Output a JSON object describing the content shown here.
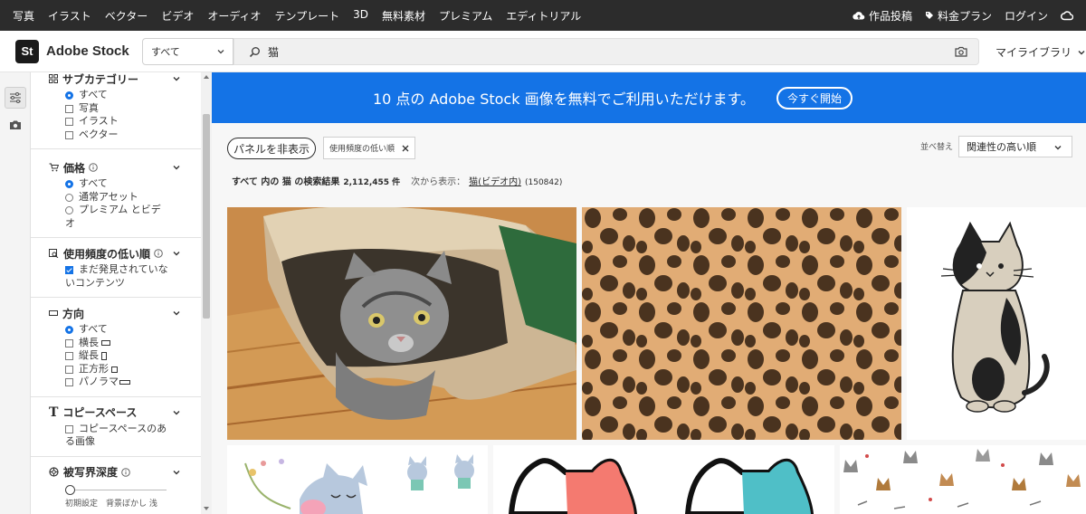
{
  "topnav": {
    "items": [
      "写真",
      "イラスト",
      "ベクター",
      "ビデオ",
      "オーディオ",
      "テンプレート",
      "3D",
      "無料素材",
      "プレミアム",
      "エディトリアル"
    ],
    "right": {
      "upload": "作品投稿",
      "pricing": "料金プラン",
      "login": "ログイン"
    }
  },
  "header": {
    "logo_badge": "St",
    "logo_text": "Adobe Stock",
    "category": "すべて",
    "search_value": "猫",
    "library": "マイライブラリ"
  },
  "filters": {
    "subcategory": {
      "title": "サブカテゴリー",
      "options": [
        {
          "label": "すべて",
          "checked": true
        },
        {
          "label": "写真",
          "checked": false
        },
        {
          "label": "イラスト",
          "checked": false
        },
        {
          "label": "ベクター",
          "checked": false
        }
      ]
    },
    "price": {
      "title": "価格",
      "options": [
        {
          "label": "すべて",
          "checked": true
        },
        {
          "label": "通常アセット",
          "checked": false
        },
        {
          "label": "プレミアム とビデ",
          "checked": false
        },
        {
          "label": "オ",
          "checked": false
        }
      ]
    },
    "undiscovered": {
      "title": "使用頻度の低い順",
      "options": [
        {
          "label": "まだ発見されていな",
          "checked": true
        },
        {
          "label": "いコンテンツ",
          "checked": false
        }
      ]
    },
    "orientation": {
      "title": "方向",
      "options": [
        {
          "label": "すべて",
          "checked": true
        },
        {
          "label": "横長",
          "checked": false
        },
        {
          "label": "縦長",
          "checked": false
        },
        {
          "label": "正方形",
          "checked": false
        },
        {
          "label": "パノラマ",
          "checked": false
        }
      ]
    },
    "copyspace": {
      "title": "コピースペース",
      "options": [
        {
          "label": "コピースペースのあ",
          "checked": false
        },
        {
          "label": "る画像",
          "checked": false
        }
      ]
    },
    "depth": {
      "title": "被写界深度",
      "slider_labels": "初期設定　背景ぼかし 浅"
    }
  },
  "banner": {
    "text": "10 点の Adobe Stock 画像を無料でご利用いただけます。",
    "cta": "今すぐ開始"
  },
  "toolbar": {
    "panel_button": "パネルを非表示",
    "active_tag": "使用頻度の低い順",
    "sort_label": "並べ替え",
    "sort_value": "関連性の高い順"
  },
  "results": {
    "prefix": "すべて 内の 猫 の検索結果",
    "count": "2,112,455 件",
    "also": "次から表示：",
    "link": "猫(ビデオ内)",
    "link_count": "(150842)"
  },
  "colors": {
    "accent": "#1473e6",
    "nav": "#2c2c2c"
  }
}
